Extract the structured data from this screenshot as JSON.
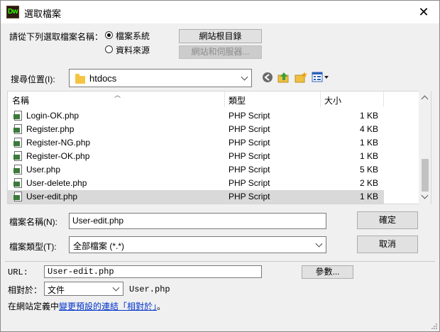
{
  "window": {
    "title": "選取檔案",
    "app_icon_text": "Dw",
    "close_symbol": "✕"
  },
  "source": {
    "label": "請從下列選取檔案名稱：",
    "options": [
      {
        "label": "檔案系統",
        "selected": true
      },
      {
        "label": "資料來源",
        "selected": false
      }
    ],
    "site_root_button": "網站根目錄",
    "server_button": "網站和伺服器..."
  },
  "location": {
    "label": "搜尋位置(I):",
    "value": "htdocs",
    "icons": [
      "back-icon",
      "up-folder-icon",
      "new-folder-icon",
      "view-menu-icon"
    ]
  },
  "file_list": {
    "columns": [
      "名稱",
      "類型",
      "大小"
    ],
    "rows": [
      {
        "name": "Login-OK.php",
        "type": "PHP Script",
        "size": "1 KB",
        "selected": false
      },
      {
        "name": "Register.php",
        "type": "PHP Script",
        "size": "4 KB",
        "selected": false
      },
      {
        "name": "Register-NG.php",
        "type": "PHP Script",
        "size": "1 KB",
        "selected": false
      },
      {
        "name": "Register-OK.php",
        "type": "PHP Script",
        "size": "1 KB",
        "selected": false
      },
      {
        "name": "User.php",
        "type": "PHP Script",
        "size": "5 KB",
        "selected": false
      },
      {
        "name": "User-delete.php",
        "type": "PHP Script",
        "size": "2 KB",
        "selected": false
      },
      {
        "name": "User-edit.php",
        "type": "PHP Script",
        "size": "1 KB",
        "selected": true
      }
    ]
  },
  "filename": {
    "label": "檔案名稱(N):",
    "value": "User-edit.php",
    "ok_button": "確定"
  },
  "filetype": {
    "label": "檔案類型(T):",
    "value": "全部檔案 (*.*)",
    "cancel_button": "取消"
  },
  "url": {
    "label": "URL:",
    "value": "User-edit.php",
    "params_button": "參數..."
  },
  "relative": {
    "label": "相對於：",
    "value": "文件",
    "target": "User.php"
  },
  "footer": {
    "prefix": "在網站定義中",
    "link": "變更預設的連結「相對於」",
    "suffix": "。"
  },
  "colors": {
    "accent_link": "#0033cc",
    "selected_row": "#d9d9d9",
    "dialog_bg": "#f0f0f0"
  }
}
